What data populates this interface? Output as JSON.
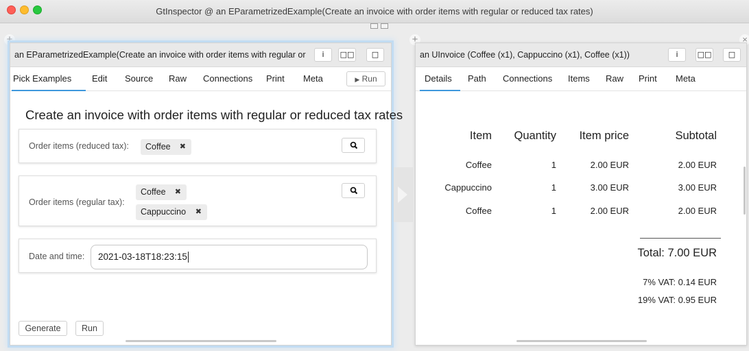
{
  "window": {
    "title": "GtInspector @ an EParametrizedExample(Create an invoice with order items with regular or reduced tax rates)"
  },
  "left_pane": {
    "title": "an EParametrizedExample(Create an invoice with order items with regular or",
    "header_buttons": [
      "i",
      "□□",
      "□"
    ],
    "tabs": [
      "Pick Examples",
      "Edit",
      "Source",
      "Raw",
      "Connections",
      "Print",
      "Meta"
    ],
    "active_tab": "Pick Examples",
    "run_label": "Run",
    "example_title": "Create an invoice with order items with regular or reduced tax rates",
    "reduced": {
      "label": "Order items (reduced tax):",
      "chips": [
        "Coffee"
      ]
    },
    "regular": {
      "label": "Order items (regular tax):",
      "chips": [
        "Coffee",
        "Cappuccino"
      ]
    },
    "date": {
      "label": "Date and time:",
      "value": "2021-03-18T18:23:15"
    },
    "generate_label": "Generate",
    "run_bottom_label": "Run"
  },
  "right_pane": {
    "title": "an UInvoice (Coffee (x1), Cappuccino (x1), Coffee (x1))",
    "header_buttons": [
      "i",
      "□□",
      "□"
    ],
    "tabs": [
      "Details",
      "Path",
      "Connections",
      "Items",
      "Raw",
      "Print",
      "Meta"
    ],
    "active_tab": "Details",
    "invoice": {
      "headers": [
        "Item",
        "Quantity",
        "Item price",
        "Subtotal"
      ],
      "rows": [
        [
          "Coffee",
          "1",
          "2.00 EUR",
          "2.00 EUR"
        ],
        [
          "Cappuccino",
          "1",
          "3.00 EUR",
          "3.00 EUR"
        ],
        [
          "Coffee",
          "1",
          "2.00 EUR",
          "2.00 EUR"
        ]
      ],
      "total": "Total: 7.00 EUR",
      "vat7": "7% VAT: 0.14 EUR",
      "vat19": "19% VAT: 0.95 EUR"
    }
  }
}
